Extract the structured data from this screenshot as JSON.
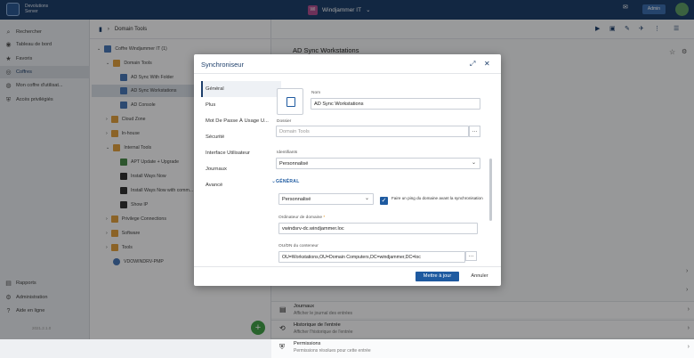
{
  "topbar": {
    "brand_line1": "Devolutions",
    "brand_line2": "Server",
    "vault_avatar": "WI",
    "vault_name": "Windjammer IT",
    "admin_label": "Admin"
  },
  "sidebar": {
    "items": [
      {
        "label": "Rechercher",
        "icon": "search-icon"
      },
      {
        "label": "Tableau de bord",
        "icon": "dashboard-icon"
      },
      {
        "label": "Favoris",
        "icon": "star-icon"
      },
      {
        "label": "Coffres",
        "icon": "vault-icon"
      },
      {
        "label": "Mon coffre d'utilisat...",
        "icon": "user-vault-icon"
      },
      {
        "label": "Accès privilégiés",
        "icon": "shield-icon"
      }
    ],
    "bottom": [
      {
        "label": "Rapports",
        "icon": "report-icon"
      },
      {
        "label": "Administration",
        "icon": "gear-icon"
      },
      {
        "label": "Aide en ligne",
        "icon": "help-icon"
      }
    ],
    "version": "2021.2.1.0"
  },
  "tree": {
    "breadcrumb": "Domain Tools",
    "nodes": [
      {
        "label": "Coffre Windjammer IT (1)",
        "color": "#4a78b6"
      },
      {
        "label": "Domain Tools",
        "color": "#e0a040"
      },
      {
        "label": "AD Sync With Folder",
        "color": "#4a78b6"
      },
      {
        "label": "AD Sync Workstations",
        "color": "#4a78b6"
      },
      {
        "label": "AD Console",
        "color": "#4a78b6"
      },
      {
        "label": "Cloud Zone",
        "color": "#e0a040"
      },
      {
        "label": "In-house",
        "color": "#e0a040"
      },
      {
        "label": "Internal Tools",
        "color": "#e0a040"
      },
      {
        "label": "APT Update + Upgrade",
        "color": "#4a8a4a"
      },
      {
        "label": "Install Ways Now",
        "color": "#333333"
      },
      {
        "label": "Install Ways Now with comm...",
        "color": "#333333"
      },
      {
        "label": "Show IP",
        "color": "#333333"
      },
      {
        "label": "Privilege Connections",
        "color": "#e0a040"
      },
      {
        "label": "Software",
        "color": "#e0a040"
      },
      {
        "label": "Tools",
        "color": "#e0a040"
      },
      {
        "label": "VDOWINDRV-PMP",
        "color": "#4a78b6"
      }
    ]
  },
  "main": {
    "title": "AD Sync Workstations",
    "rows": [
      {
        "title": "Journaux",
        "subtitle": "Afficher le journal des entrées",
        "icon": "log-icon"
      },
      {
        "title": "Historique de l'entrée",
        "subtitle": "Afficher l'historique de l'entrée",
        "icon": "history-icon"
      },
      {
        "title": "Permissions",
        "subtitle": "Permissions résolues pour cette entrée",
        "icon": "permission-icon"
      }
    ]
  },
  "modal": {
    "title": "Synchroniseur",
    "nav": [
      "Général",
      "Plus",
      "Mot De Passe À Usage U...",
      "Sécurité",
      "Interface Utilisateur",
      "Journaux",
      "Avancé"
    ],
    "name_label": "Nom",
    "name_value": "AD Sync Workstations",
    "folder_label": "Dossier",
    "folder_placeholder": "Domain Tools",
    "credentials_label": "Identifiants",
    "credentials_value": "Personnalisé",
    "section_general": "GÉNÉRAL",
    "mode_value": "Personnalisé",
    "ping_label": "Faire un ping du domaine avant la synchronisation",
    "dc_label": "Ordinateur de domaine",
    "dc_value": "vwindsrv-dc.windjammer.loc",
    "ou_label": "OU/DN du conteneur",
    "ou_value": "OU=Workstations,OU=Domain Computers,DC=windjammer,DC=loc",
    "update_button": "Mettre à jour",
    "cancel_button": "Annuler"
  }
}
